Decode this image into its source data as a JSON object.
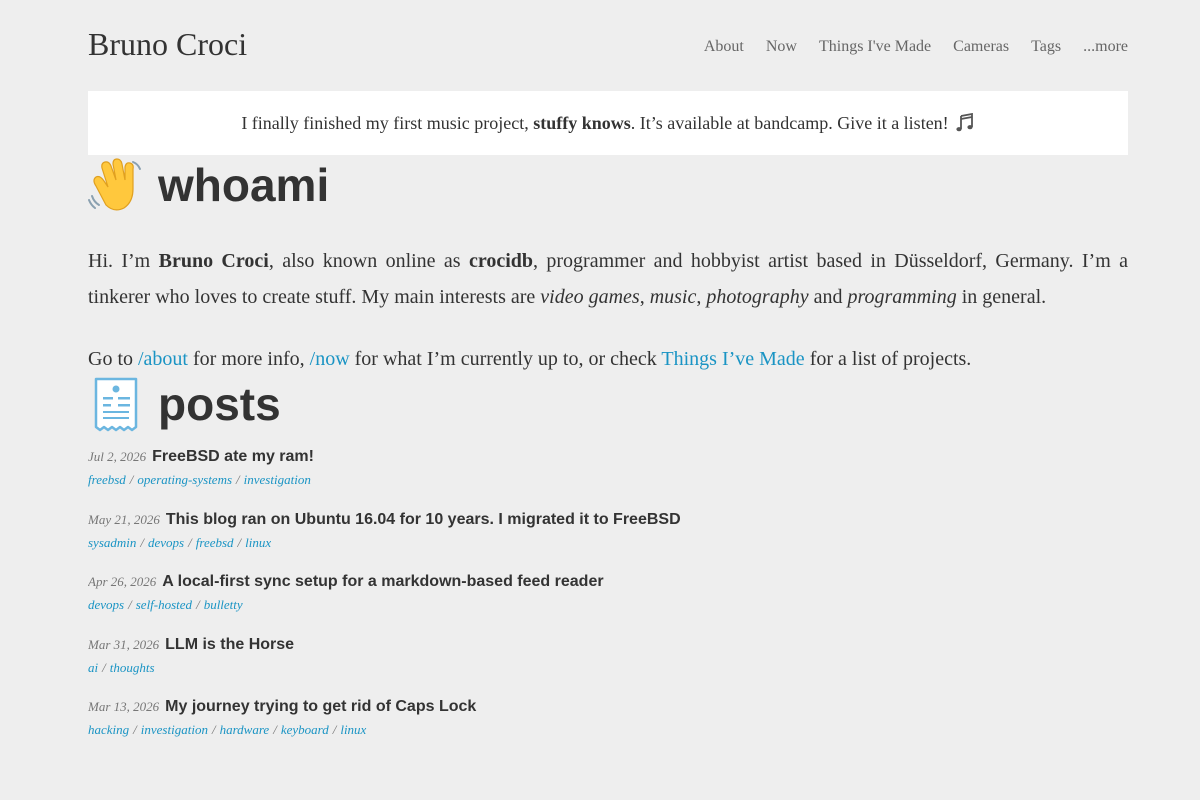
{
  "site": {
    "title": "Bruno Croci"
  },
  "nav": {
    "items": [
      "About",
      "Now",
      "Things I've Made",
      "Cameras",
      "Tags",
      "...more"
    ]
  },
  "announcement": {
    "before": "I finally finished my first music project, ",
    "project": "stuffy knows",
    "after": ". It’s available at bandcamp. Give it a listen! ",
    "icon": "music-note-icon"
  },
  "whoami": {
    "heading": "whoami",
    "icon": "waving-hand-icon",
    "intro": {
      "p1": "Hi. I’m ",
      "name": "Bruno Croci",
      "p2": ", also known online as ",
      "handle": "crocidb",
      "p3": ", programmer and hobbyist artist based in Düsseldorf, Germany. I’m a tinkerer who loves to create stuff. My main interests are ",
      "i1": "video games",
      "c1": ", ",
      "i2": "music",
      "c2": ", ",
      "i3": "photography",
      "and": " and ",
      "i4": "programming",
      "end": " in general."
    },
    "goto": {
      "t1": "Go to ",
      "about_link": "/about",
      "t2": " for more info, ",
      "now_link": "/now",
      "t3": " for what I’m currently up to, or check ",
      "things_link": "Things I’ve Made",
      "t4": " for a list of projects."
    }
  },
  "posts": {
    "heading": "posts",
    "icon": "receipt-icon",
    "items": [
      {
        "date": "Jul 2, 2026",
        "title": "FreeBSD ate my ram!",
        "tags": [
          "freebsd",
          "operating-systems",
          "investigation"
        ]
      },
      {
        "date": "May 21, 2026",
        "title": "This blog ran on Ubuntu 16.04 for 10 years. I migrated it to FreeBSD",
        "tags": [
          "sysadmin",
          "devops",
          "freebsd",
          "linux"
        ]
      },
      {
        "date": "Apr 26, 2026",
        "title": "A local-first sync setup for a markdown-based feed reader",
        "tags": [
          "devops",
          "self-hosted",
          "bulletty"
        ]
      },
      {
        "date": "Mar 31, 2026",
        "title": "LLM is the Horse",
        "tags": [
          "ai",
          "thoughts"
        ]
      },
      {
        "date": "Mar 13, 2026",
        "title": "My journey trying to get rid of Caps Lock",
        "tags": [
          "hacking",
          "investigation",
          "hardware",
          "keyboard",
          "linux"
        ]
      }
    ]
  },
  "colors": {
    "background": "#eeeeee",
    "text": "#333333",
    "link": "#1a94c4",
    "nav": "#666666",
    "banner": "#ffffff"
  }
}
